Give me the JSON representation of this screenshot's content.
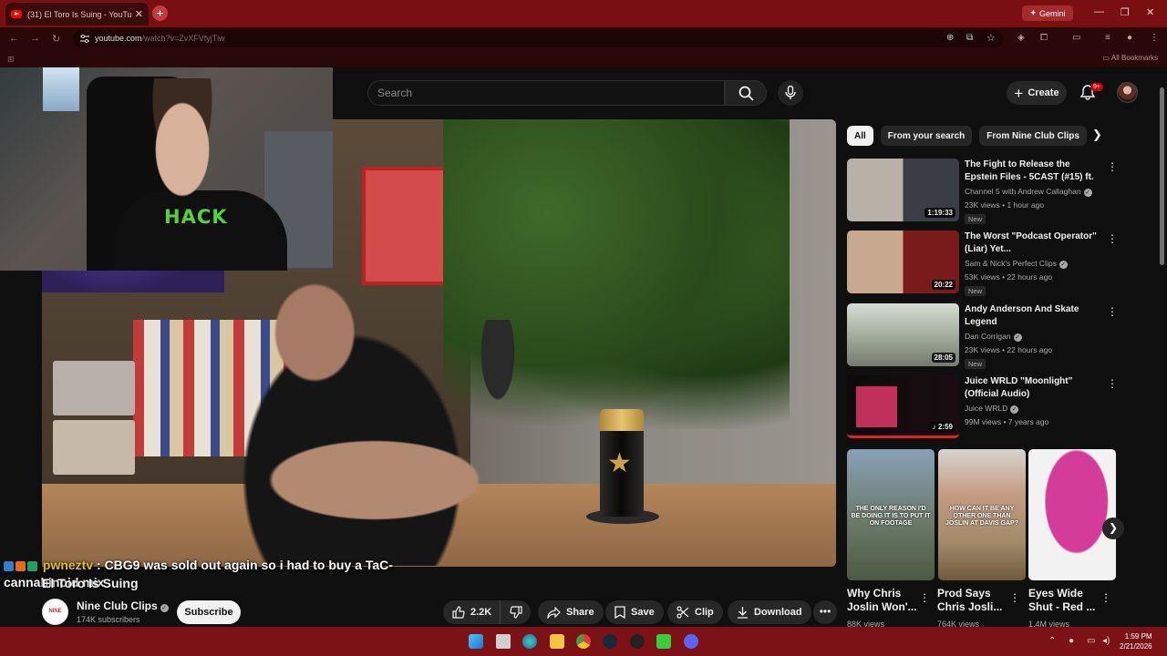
{
  "browser": {
    "tab_title": "(31) El Toro Is Suing - YouTube",
    "tab_close": "✕",
    "new_tab": "+",
    "gemini": "Gemini",
    "url_main": "youtube.com",
    "url_rest": "/watch?v=ZvXFVfyjTiw",
    "bookmarks": "All Bookmarks"
  },
  "header": {
    "search_placeholder": "Search",
    "create": "Create",
    "notif_count": "9+"
  },
  "chat": {
    "username": "pwneztv",
    "message": " : CBG9 was sold out again so i had to buy a TaC-cannabinoid mix"
  },
  "video": {
    "title": "El Toro Is Suing",
    "channel": "Nine Club Clips",
    "subscribers": "174K subscribers",
    "channel_avatar_text": "NINE",
    "subscribe": "Subscribe",
    "likes": "2.2K",
    "share": "Share",
    "save": "Save",
    "clip": "Clip",
    "download": "Download",
    "more": "•••",
    "can_star": "★"
  },
  "webcam": {
    "shirt_text": "HACK"
  },
  "chips": [
    "All",
    "From your search",
    "From Nine Club Clips"
  ],
  "recommendations": [
    {
      "title": "The Fight to Release the Epstein Files - 5CAST (#15) ft. ...",
      "channel": "Channel 5 with Andrew Callaghan",
      "meta": "23K views • 1 hour ago",
      "duration": "1:19:33",
      "badge": "New"
    },
    {
      "title": "The Worst \"Podcast Operator\" (Liar) Yet...",
      "channel": "Sam & Nick's Perfect Clips",
      "meta": "53K views • 22 hours ago",
      "duration": "20:22",
      "badge": "New"
    },
    {
      "title": "Andy Anderson And Skate Legend",
      "channel": "Dan Corrigan",
      "meta": "23K views • 22 hours ago",
      "duration": "28:05",
      "badge": "New"
    },
    {
      "title": "Juice WRLD \"Moonlight\" (Official Audio)",
      "channel": "Juice WRLD",
      "meta": "99M views • 7 years ago",
      "duration": "♪ 2:59",
      "badge": ""
    }
  ],
  "shorts": [
    {
      "title": "Why Chris Joslin Won'...",
      "views": "88K views",
      "caption": "THE ONLY REASON I'D BE DOING IT IS TO PUT IT ON FOOTAGE"
    },
    {
      "title": "Prod Says Chris Josli...",
      "views": "764K views",
      "caption": "HOW CAN IT BE ANY OTHER ONE THAN JOSLIN AT DAVIS GAP?"
    },
    {
      "title": "Eyes Wide Shut - Red ...",
      "views": "1.4M views",
      "caption": ""
    }
  ],
  "taskbar": {
    "time": "1:59 PM",
    "date": "2/21/2026"
  },
  "colors": {
    "browser_red": "#7a0f12",
    "yt_bg": "#0f0f0f",
    "accent": "#cc0000"
  }
}
